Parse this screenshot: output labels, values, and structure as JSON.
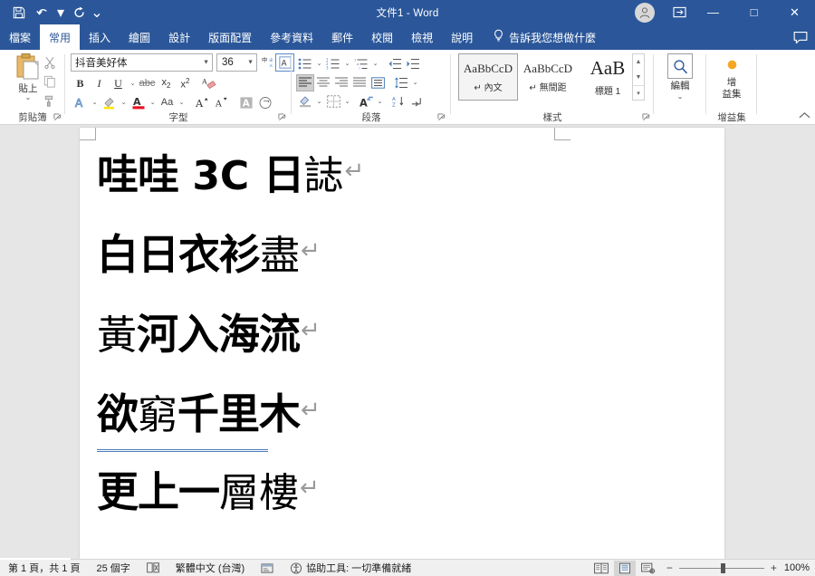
{
  "titlebar": {
    "document_title": "文件1  -  Word",
    "qat": [
      {
        "name": "save",
        "icon": "save-icon"
      },
      {
        "name": "undo",
        "icon": "undo-icon"
      },
      {
        "name": "redo",
        "icon": "redo-icon"
      },
      {
        "name": "customize-qat",
        "icon": "chevron-down-icon"
      }
    ],
    "account_icon": "user-avatar-icon",
    "ribbon_display_icon": "ribbon-display-options-icon",
    "minimize": "—",
    "maximize": "□",
    "close": "✕"
  },
  "tabs": [
    {
      "label": "檔案",
      "active": false
    },
    {
      "label": "常用",
      "active": true
    },
    {
      "label": "插入",
      "active": false
    },
    {
      "label": "繪圖",
      "active": false
    },
    {
      "label": "設計",
      "active": false
    },
    {
      "label": "版面配置",
      "active": false
    },
    {
      "label": "參考資料",
      "active": false
    },
    {
      "label": "郵件",
      "active": false
    },
    {
      "label": "校閱",
      "active": false
    },
    {
      "label": "檢視",
      "active": false
    },
    {
      "label": "說明",
      "active": false
    }
  ],
  "tell_me": {
    "icon": "lightbulb-icon",
    "label": "告訴我您想做什麼"
  },
  "comments_icon": "comment-icon",
  "ribbon": {
    "clipboard": {
      "group_label": "剪貼簿",
      "paste_label": "貼上",
      "paste_icon": "clipboard-paste-icon",
      "cut_icon": "scissors-icon",
      "copy_icon": "copy-icon",
      "format_painter_icon": "format-painter-icon",
      "dialog_launcher": "⌐"
    },
    "font": {
      "group_label": "字型",
      "font_name": "抖音美好体",
      "font_size": "36",
      "phonetic_guide_icon": "phonetic-guide-icon",
      "char_border_icon": "character-border-icon",
      "bold": "B",
      "italic": "I",
      "underline": "U",
      "strikethrough_icon": "strikethrough-icon",
      "subscript_icon": "subscript-icon",
      "superscript_icon": "superscript-icon",
      "clear_format_icon": "clear-formatting-icon",
      "text_effects_icon": "text-effects-icon",
      "highlight_icon": "text-highlight-icon",
      "font_color_icon": "font-color-icon",
      "change_case_icon": "change-case-icon",
      "grow_font_icon": "grow-font-icon",
      "shrink_font_icon": "shrink-font-icon",
      "char_shading_icon": "character-shading-icon",
      "enclose_char_icon": "enclose-character-icon",
      "dialog_launcher": "⌐"
    },
    "paragraph": {
      "group_label": "段落",
      "bullets_icon": "bullet-list-icon",
      "numbering_icon": "numbered-list-icon",
      "multilevel_icon": "multilevel-list-icon",
      "decrease_indent_icon": "decrease-indent-icon",
      "increase_indent_icon": "increase-indent-icon",
      "align_left_icon": "align-left-icon",
      "align_center_icon": "align-center-icon",
      "align_right_icon": "align-right-icon",
      "justify_icon": "justify-icon",
      "distribute_icon": "distribute-text-icon",
      "line_spacing_icon": "line-spacing-icon",
      "shading_icon": "paragraph-shading-icon",
      "borders_icon": "borders-icon",
      "asian_layout_icon": "asian-layout-icon",
      "sort_icon": "sort-icon",
      "show_marks_icon": "show-formatting-marks-icon",
      "dialog_launcher": "⌐"
    },
    "styles": {
      "group_label": "樣式",
      "items": [
        {
          "preview": "AaBbCcD",
          "name": "↵ 內文",
          "selected": true
        },
        {
          "preview": "AaBbCcD",
          "name": "↵ 無間距",
          "selected": false
        },
        {
          "preview": "AaB",
          "name": "標題 1",
          "selected": false
        }
      ],
      "scroll_up_icon": "chevron-up-icon",
      "scroll_down_icon": "chevron-down-icon",
      "more_icon": "more-styles-icon",
      "dialog_launcher": "⌐"
    },
    "editing": {
      "group_label": "",
      "label": "編輯",
      "icon": "search-icon",
      "caret": "⌄"
    },
    "addins": {
      "group_label": "增益集",
      "label": "增\n益集",
      "label_line1": "增",
      "label_line2": "益集",
      "icon": "addins-dot-icon"
    },
    "collapse_icon": "collapse-ribbon-icon"
  },
  "document": {
    "lines": [
      {
        "segments": [
          {
            "text": "哇哇",
            "style": "bold"
          },
          {
            "text": " 3C ",
            "style": "latin"
          },
          {
            "text": "日",
            "style": "bold"
          },
          {
            "text": "誌",
            "style": "thin"
          }
        ],
        "pilcrow": "↵",
        "squiggle": false
      },
      {
        "segments": [
          {
            "text": "白日衣衫",
            "style": "bold"
          },
          {
            "text": "盡",
            "style": "thin"
          }
        ],
        "pilcrow": "↵",
        "squiggle": false
      },
      {
        "segments": [
          {
            "text": "黃",
            "style": "thin"
          },
          {
            "text": "河入海流",
            "style": "bold"
          }
        ],
        "pilcrow": "↵",
        "squiggle": false
      },
      {
        "segments": [
          {
            "text": "欲",
            "style": "bold"
          },
          {
            "text": "窮",
            "style": "thin"
          },
          {
            "text": "千里木",
            "style": "bold"
          }
        ],
        "pilcrow": "↵",
        "squiggle": true
      },
      {
        "segments": [
          {
            "text": "更上一",
            "style": "bold"
          },
          {
            "text": "層樓",
            "style": "thin"
          }
        ],
        "pilcrow": "↵",
        "squiggle": false
      }
    ]
  },
  "statusbar": {
    "page_info": "第 1 頁，共 1 頁",
    "word_count": "25 個字",
    "proofing_icon": "proofing-errors-icon",
    "language": "繁體中文 (台灣)",
    "track_changes_icon": "track-changes-icon",
    "accessibility_icon": "accessibility-icon",
    "accessibility_text": "協助工具: 一切準備就緒",
    "views": [
      {
        "name": "read-mode",
        "icon": "read-mode-icon",
        "selected": false
      },
      {
        "name": "print-layout",
        "icon": "print-layout-icon",
        "selected": true
      },
      {
        "name": "web-layout",
        "icon": "web-layout-icon",
        "selected": false
      }
    ],
    "zoom_out": "−",
    "zoom_in": "+",
    "zoom_level": "100%"
  },
  "colors": {
    "word_blue": "#2b579a",
    "ribbon_bg": "#ffffff",
    "doc_bg": "#e6e6e6",
    "status_bg": "#f0f0f0",
    "squiggle_blue": "#4a7ebb",
    "addin_orange": "#f5a623"
  }
}
